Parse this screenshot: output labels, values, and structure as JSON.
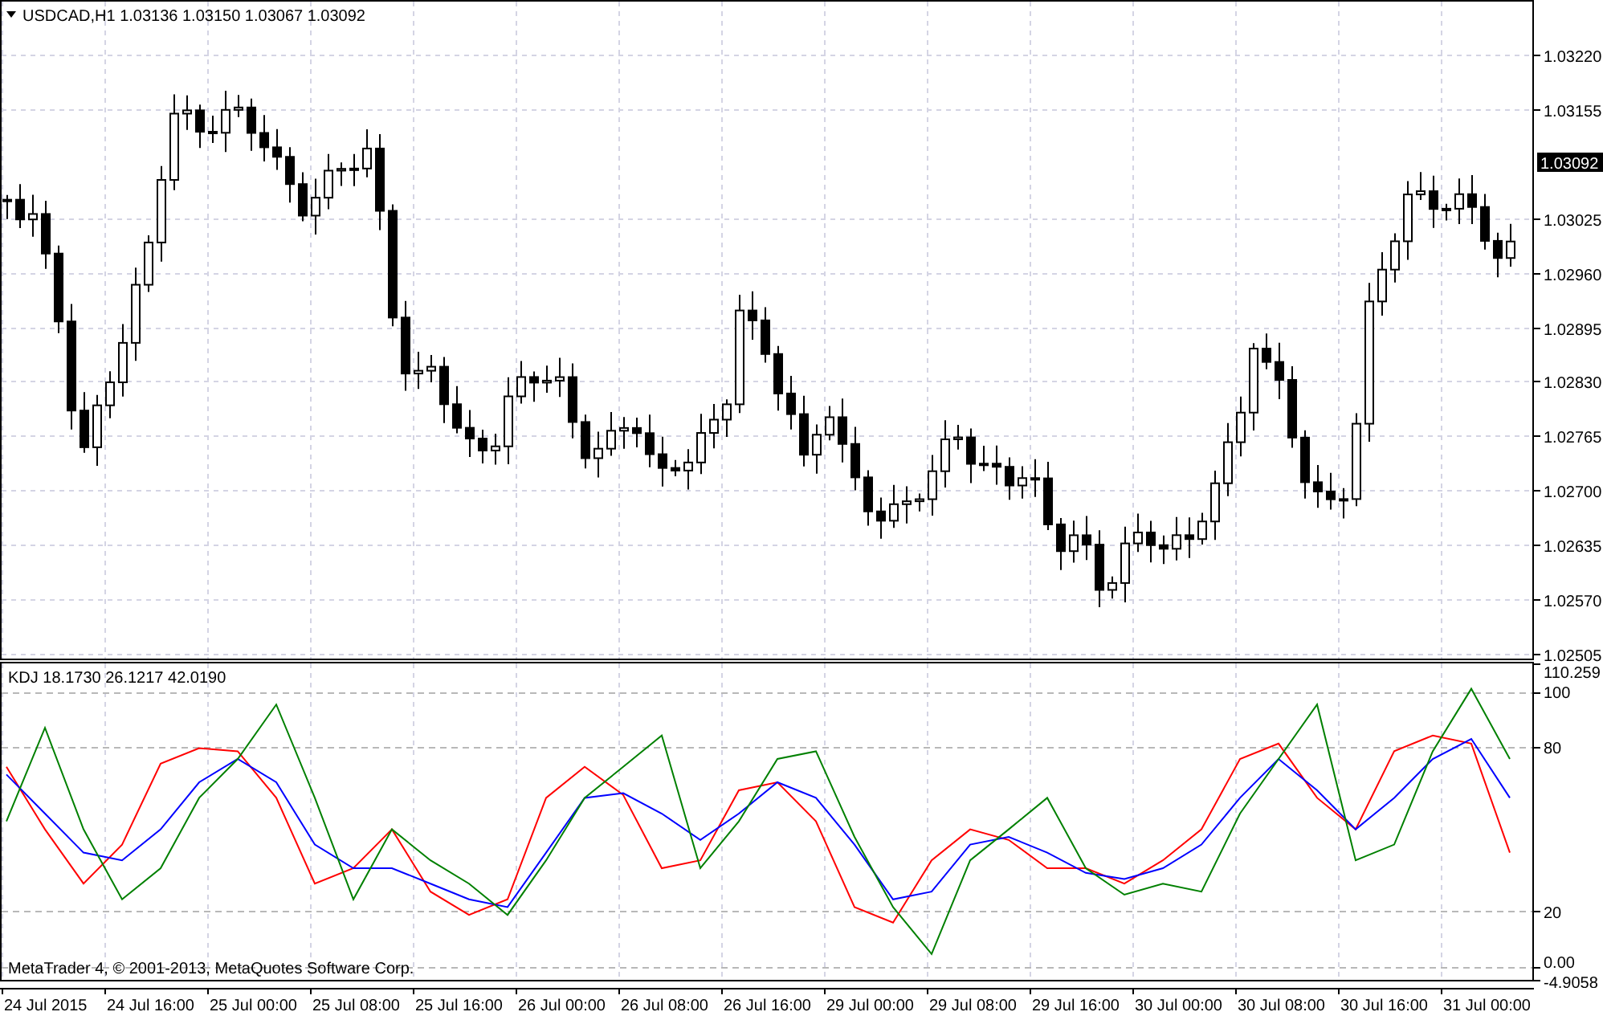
{
  "chart": {
    "symbol": "USDCAD,H1",
    "quotes": [
      "1.03136",
      "1.03150",
      "1.03067",
      "1.03092"
    ],
    "price_axis": {
      "labels": [
        "1.03220",
        "1.03155",
        "1.03025",
        "1.02960",
        "1.02895",
        "1.02830",
        "1.02765",
        "1.02700",
        "1.02635",
        "1.02570",
        "1.02505"
      ],
      "current": "1.03092"
    }
  },
  "indicator": {
    "name": "KDJ",
    "readings": [
      "18.1730",
      "26.1217",
      "42.0190"
    ],
    "chart_data": {
      "type": "line",
      "grid": true,
      "series": [
        {
          "color": "#ff0000",
          "values": [
            72.6,
            49.9,
            30.1,
            44.3,
            73.8,
            79.4,
            78.3,
            61.3,
            30.1,
            35.7,
            49.9,
            27.2,
            18.7,
            24.4,
            61.3,
            72.6,
            62.4,
            35.7,
            38.6,
            64.1,
            67.0,
            52.8,
            21.6,
            15.9,
            38.6,
            49.9,
            46.0,
            35.7,
            35.7,
            30.1,
            38.6,
            49.9,
            75.5,
            81.1,
            61.3,
            49.9,
            78.3,
            84.0,
            81.1,
            41.4
          ]
        },
        {
          "color": "#0000ff",
          "values": [
            69.8,
            55.6,
            41.4,
            38.6,
            49.9,
            67.0,
            75.5,
            67.0,
            44.3,
            35.7,
            35.7,
            30.1,
            24.4,
            21.6,
            41.4,
            61.3,
            63.0,
            55.6,
            46.0,
            55.6,
            67.0,
            61.3,
            44.3,
            24.4,
            27.2,
            44.3,
            47.1,
            41.4,
            34.0,
            31.8,
            35.7,
            44.3,
            61.3,
            75.5,
            64.1,
            49.9,
            61.3,
            75.5,
            82.8,
            61.3
          ]
        },
        {
          "color": "#008000",
          "values": [
            52.8,
            86.8,
            49.9,
            24.4,
            35.7,
            61.3,
            75.5,
            95.3,
            61.3,
            24.4,
            49.9,
            38.6,
            30.1,
            18.7,
            38.6,
            61.3,
            72.6,
            84.0,
            35.7,
            52.8,
            75.5,
            78.3,
            47.1,
            21.6,
            4.5,
            38.6,
            49.9,
            61.3,
            35.7,
            26.1,
            30.1,
            27.2,
            55.6,
            75.5,
            95.3,
            38.6,
            44.3,
            78.3,
            101.0,
            75.5
          ]
        }
      ],
      "ylim": [
        -4.9058,
        110.2596
      ],
      "yticks": [
        {
          "value": 110.259,
          "label": "110.259"
        },
        100,
        80,
        20,
        {
          "value": 0,
          "label": "0.00"
        },
        {
          "value": -4.9058,
          "label": "-4.9058"
        }
      ]
    }
  },
  "copyright": "MetaTrader 4, © 2001-2013, MetaQuotes Software Corp.",
  "time_axis": {
    "labels": [
      "24 Jul 2015",
      "24 Jul 16:00",
      "25 Jul 00:00",
      "25 Jul 08:00",
      "25 Jul 16:00",
      "26 Jul 00:00",
      "26 Jul 08:00",
      "26 Jul 16:00",
      "29 Jul 00:00",
      "29 Jul 08:00",
      "29 Jul 16:00",
      "30 Jul 00:00",
      "30 Jul 08:00",
      "30 Jul 16:00",
      "31 Jul 00:00"
    ]
  }
}
